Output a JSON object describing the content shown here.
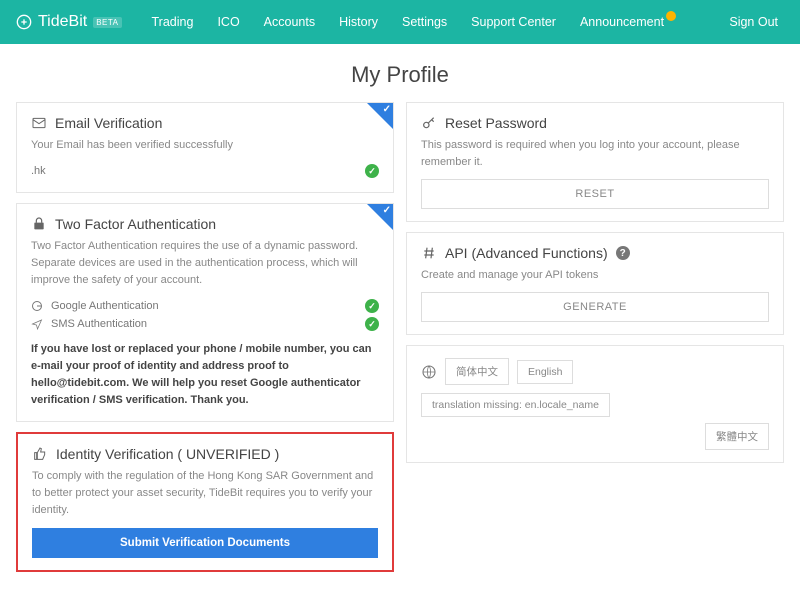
{
  "brand": {
    "name": "TideBit",
    "beta": "BETA"
  },
  "nav": {
    "trading": "Trading",
    "ico": "ICO",
    "accounts": "Accounts",
    "history": "History",
    "settings": "Settings",
    "support": "Support Center",
    "announcement": "Announcement",
    "signout": "Sign Out"
  },
  "page_title": "My Profile",
  "email_card": {
    "title": "Email Verification",
    "desc": "Your Email has been verified successfully",
    "value": ".hk"
  },
  "tfa_card": {
    "title": "Two Factor Authentication",
    "desc": "Two Factor Authentication requires the use of a dynamic password. Separate devices are used in the authentication process, which will improve the safety of your account.",
    "google": "Google Authentication",
    "sms": "SMS Authentication",
    "note": "If you have lost or replaced your phone / mobile number, you can e-mail your proof of identity and address proof to hello@tidebit.com. We will help you reset Google authenticator verification / SMS verification. Thank you."
  },
  "identity_card": {
    "title": "Identity Verification ( UNVERIFIED )",
    "desc": "To comply with the regulation of the Hong Kong SAR Government and to better protect your asset security, TideBit requires you to verify your identity.",
    "button": "Submit Verification Documents"
  },
  "reset_card": {
    "title": "Reset Password",
    "desc": "This password is required when you log into your account, please remember it.",
    "button": "RESET"
  },
  "api_card": {
    "title": "API (Advanced Functions)",
    "desc": "Create and manage your API tokens",
    "button": "GENERATE"
  },
  "lang_card": {
    "opt1": "简体中文",
    "opt2": "English",
    "opt3": "translation missing: en.locale_name",
    "opt4": "繁體中文"
  }
}
